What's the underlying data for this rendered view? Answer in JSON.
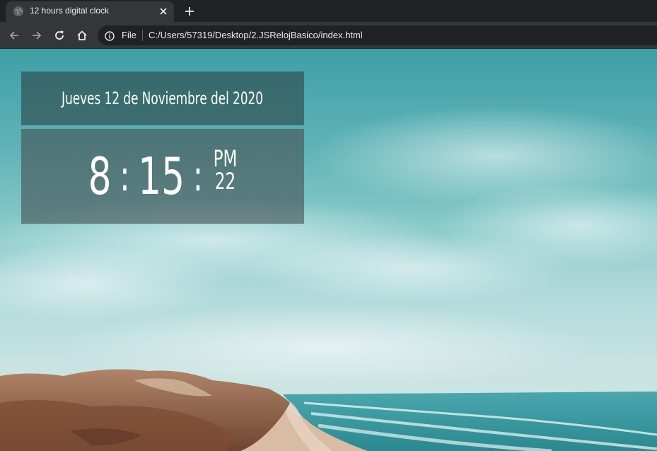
{
  "browser": {
    "tab": {
      "title": "12 hours digital clock",
      "favicon": "globe-icon",
      "close_icon": "close-icon"
    },
    "new_tab_icon": "plus-icon",
    "nav": {
      "back_icon": "arrow-left-icon",
      "forward_icon": "arrow-right-icon",
      "reload_icon": "reload-icon",
      "home_icon": "home-icon"
    },
    "omnibox": {
      "info_icon": "info-icon",
      "scheme": "File",
      "url": "C:/Users/57319/Desktop/2.JSRelojBasico/index.html"
    },
    "colors": {
      "tabbar": "#202124",
      "toolbar": "#35363a",
      "text": "#e8eaed"
    }
  },
  "clock": {
    "date": "Jueves 12 de Noviembre del 2020",
    "hours": "8",
    "separator": ":",
    "minutes": "15",
    "ampm": "PM",
    "seconds": "22",
    "colors": {
      "date_box": "rgba(45,70,72,0.62)",
      "time_box": "rgba(70,80,82,0.62)",
      "text": "#ffffff"
    }
  },
  "background": {
    "scene": "beach-coastline-photo",
    "colors": {
      "sky_top": "#3e9fa5",
      "sky_bottom": "#cfe5e4",
      "sea": "#2e8e96",
      "sand": "#c8a285",
      "hills": "#8a5a3e"
    }
  }
}
